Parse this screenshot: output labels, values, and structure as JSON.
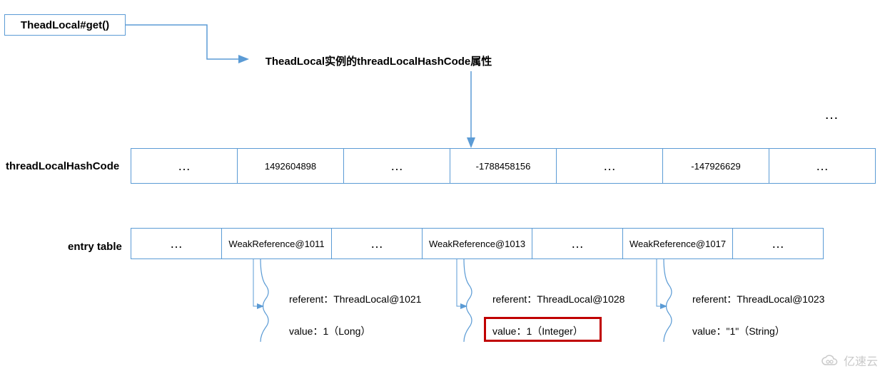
{
  "top": {
    "get_call": "TheadLocal#get()",
    "hash_prop": "TheadLocal实例的threadLocalHashCode属性"
  },
  "float_ellipsis": "…",
  "labels": {
    "hash_row": "threadLocalHashCode",
    "entry_row": "entry table"
  },
  "hash_row": [
    "…",
    "1492604898",
    "…",
    "-1788458156",
    "…",
    "-147926629",
    "…"
  ],
  "entry_row": [
    {
      "txt": "…",
      "w": 128
    },
    {
      "txt": "WeakReference@1011",
      "w": 155
    },
    {
      "txt": "…",
      "w": 128
    },
    {
      "txt": "WeakReference@1013",
      "w": 155
    },
    {
      "txt": "…",
      "w": 128
    },
    {
      "txt": "WeakReference@1017",
      "w": 155
    },
    {
      "txt": "…",
      "w": 128
    }
  ],
  "details": [
    {
      "ref": "referent：ThreadLocal@1021",
      "val": "value：1（Long）"
    },
    {
      "ref": "referent：ThreadLocal@1028",
      "val": "value：1（Integer）"
    },
    {
      "ref": "referent：ThreadLocal@1023",
      "val": "value：\"1\"（String）"
    }
  ],
  "watermark": "亿速云",
  "chart_data": {
    "type": "table",
    "title": "ThreadLocal lookup diagram",
    "flow": [
      "TheadLocal#get()",
      "TheadLocal实例的threadLocalHashCode属性",
      "threadLocalHashCode row",
      "entry table row",
      "WeakReference entry",
      "referent / value"
    ],
    "hash_codes": [
      1492604898,
      -1788458156,
      -147926629
    ],
    "entries": [
      {
        "weak_ref": "WeakReference@1011",
        "referent": "ThreadLocal@1021",
        "value": "1 (Long)"
      },
      {
        "weak_ref": "WeakReference@1013",
        "referent": "ThreadLocal@1028",
        "value": "1 (Integer)",
        "highlighted": true
      },
      {
        "weak_ref": "WeakReference@1017",
        "referent": "ThreadLocal@1023",
        "value": "\"1\" (String)"
      }
    ]
  }
}
